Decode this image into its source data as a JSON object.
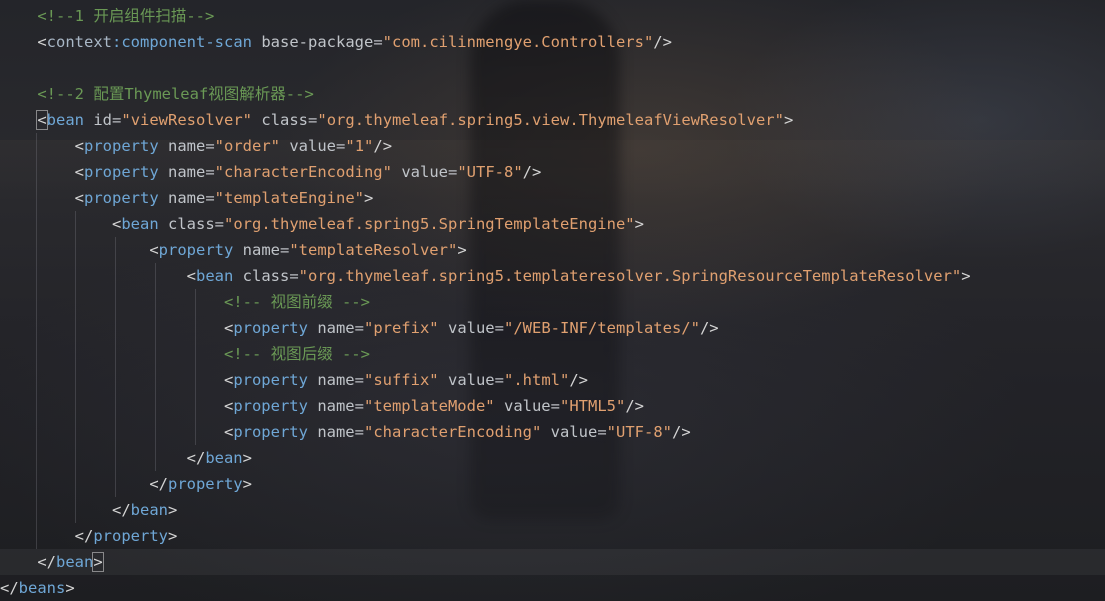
{
  "editor": {
    "lines": [
      {
        "indent": 4,
        "parts": [
          {
            "t": "comment",
            "s": "<!--1 开启组件扫描-->"
          }
        ]
      },
      {
        "indent": 4,
        "parts": [
          {
            "t": "bracket",
            "s": "<"
          },
          {
            "t": "ns",
            "s": "context"
          },
          {
            "t": "tag",
            "s": ":component-scan"
          },
          {
            "t": "plain",
            "s": " "
          },
          {
            "t": "attr",
            "s": "base-package"
          },
          {
            "t": "plain",
            "s": "="
          },
          {
            "t": "str",
            "s": "\"com.cilinmengye.Controllers\""
          },
          {
            "t": "bracket",
            "s": "/>"
          }
        ]
      },
      {
        "indent": 0,
        "parts": []
      },
      {
        "indent": 4,
        "parts": [
          {
            "t": "comment",
            "s": "<!--2 配置Thymeleaf视图解析器-->"
          }
        ]
      },
      {
        "indent": 4,
        "parts": [
          {
            "t": "bracket-box",
            "s": "<"
          },
          {
            "t": "tag",
            "s": "bean"
          },
          {
            "t": "plain",
            "s": " "
          },
          {
            "t": "attr",
            "s": "id"
          },
          {
            "t": "plain",
            "s": "="
          },
          {
            "t": "str",
            "s": "\"viewResolver\""
          },
          {
            "t": "plain",
            "s": " "
          },
          {
            "t": "attr",
            "s": "class"
          },
          {
            "t": "plain",
            "s": "="
          },
          {
            "t": "str",
            "s": "\"org.thymeleaf.spring5.view.ThymeleafViewResolver\""
          },
          {
            "t": "bracket",
            "s": ">"
          }
        ]
      },
      {
        "indent": 8,
        "parts": [
          {
            "t": "bracket",
            "s": "<"
          },
          {
            "t": "tag",
            "s": "property"
          },
          {
            "t": "plain",
            "s": " "
          },
          {
            "t": "attr",
            "s": "name"
          },
          {
            "t": "plain",
            "s": "="
          },
          {
            "t": "str",
            "s": "\"order\""
          },
          {
            "t": "plain",
            "s": " "
          },
          {
            "t": "attr",
            "s": "value"
          },
          {
            "t": "plain",
            "s": "="
          },
          {
            "t": "str",
            "s": "\"1\""
          },
          {
            "t": "bracket",
            "s": "/>"
          }
        ]
      },
      {
        "indent": 8,
        "parts": [
          {
            "t": "bracket",
            "s": "<"
          },
          {
            "t": "tag",
            "s": "property"
          },
          {
            "t": "plain",
            "s": " "
          },
          {
            "t": "attr",
            "s": "name"
          },
          {
            "t": "plain",
            "s": "="
          },
          {
            "t": "str",
            "s": "\"characterEncoding\""
          },
          {
            "t": "plain",
            "s": " "
          },
          {
            "t": "attr",
            "s": "value"
          },
          {
            "t": "plain",
            "s": "="
          },
          {
            "t": "str",
            "s": "\"UTF-8\""
          },
          {
            "t": "bracket",
            "s": "/>"
          }
        ]
      },
      {
        "indent": 8,
        "parts": [
          {
            "t": "bracket",
            "s": "<"
          },
          {
            "t": "tag",
            "s": "property"
          },
          {
            "t": "plain",
            "s": " "
          },
          {
            "t": "attr",
            "s": "name"
          },
          {
            "t": "plain",
            "s": "="
          },
          {
            "t": "str",
            "s": "\"templateEngine\""
          },
          {
            "t": "bracket",
            "s": ">"
          }
        ]
      },
      {
        "indent": 12,
        "parts": [
          {
            "t": "bracket",
            "s": "<"
          },
          {
            "t": "tag",
            "s": "bean"
          },
          {
            "t": "plain",
            "s": " "
          },
          {
            "t": "attr",
            "s": "class"
          },
          {
            "t": "plain",
            "s": "="
          },
          {
            "t": "str",
            "s": "\"org.thymeleaf.spring5.SpringTemplateEngine\""
          },
          {
            "t": "bracket",
            "s": ">"
          }
        ]
      },
      {
        "indent": 16,
        "parts": [
          {
            "t": "bracket",
            "s": "<"
          },
          {
            "t": "tag",
            "s": "property"
          },
          {
            "t": "plain",
            "s": " "
          },
          {
            "t": "attr",
            "s": "name"
          },
          {
            "t": "plain",
            "s": "="
          },
          {
            "t": "str",
            "s": "\"templateResolver\""
          },
          {
            "t": "bracket",
            "s": ">"
          }
        ]
      },
      {
        "indent": 20,
        "parts": [
          {
            "t": "bracket",
            "s": "<"
          },
          {
            "t": "tag",
            "s": "bean"
          },
          {
            "t": "plain",
            "s": " "
          },
          {
            "t": "attr",
            "s": "class"
          },
          {
            "t": "plain",
            "s": "="
          },
          {
            "t": "str",
            "s": "\"org.thymeleaf.spring5.templateresolver.SpringResourceTemplateResolver\""
          },
          {
            "t": "bracket",
            "s": ">"
          }
        ]
      },
      {
        "indent": 24,
        "parts": [
          {
            "t": "comment",
            "s": "<!-- 视图前缀 -->"
          }
        ]
      },
      {
        "indent": 24,
        "parts": [
          {
            "t": "bracket",
            "s": "<"
          },
          {
            "t": "tag",
            "s": "property"
          },
          {
            "t": "plain",
            "s": " "
          },
          {
            "t": "attr",
            "s": "name"
          },
          {
            "t": "plain",
            "s": "="
          },
          {
            "t": "str",
            "s": "\"prefix\""
          },
          {
            "t": "plain",
            "s": " "
          },
          {
            "t": "attr",
            "s": "value"
          },
          {
            "t": "plain",
            "s": "="
          },
          {
            "t": "str",
            "s": "\"/WEB-INF/templates/\""
          },
          {
            "t": "bracket",
            "s": "/>"
          }
        ]
      },
      {
        "indent": 24,
        "parts": [
          {
            "t": "comment",
            "s": "<!-- 视图后缀 -->"
          }
        ]
      },
      {
        "indent": 24,
        "parts": [
          {
            "t": "bracket",
            "s": "<"
          },
          {
            "t": "tag",
            "s": "property"
          },
          {
            "t": "plain",
            "s": " "
          },
          {
            "t": "attr",
            "s": "name"
          },
          {
            "t": "plain",
            "s": "="
          },
          {
            "t": "str",
            "s": "\"suffix\""
          },
          {
            "t": "plain",
            "s": " "
          },
          {
            "t": "attr",
            "s": "value"
          },
          {
            "t": "plain",
            "s": "="
          },
          {
            "t": "str",
            "s": "\".html\""
          },
          {
            "t": "bracket",
            "s": "/>"
          }
        ]
      },
      {
        "indent": 24,
        "parts": [
          {
            "t": "bracket",
            "s": "<"
          },
          {
            "t": "tag",
            "s": "property"
          },
          {
            "t": "plain",
            "s": " "
          },
          {
            "t": "attr",
            "s": "name"
          },
          {
            "t": "plain",
            "s": "="
          },
          {
            "t": "str",
            "s": "\"templateMode\""
          },
          {
            "t": "plain",
            "s": " "
          },
          {
            "t": "attr",
            "s": "value"
          },
          {
            "t": "plain",
            "s": "="
          },
          {
            "t": "str",
            "s": "\"HTML5\""
          },
          {
            "t": "bracket",
            "s": "/>"
          }
        ]
      },
      {
        "indent": 24,
        "parts": [
          {
            "t": "bracket",
            "s": "<"
          },
          {
            "t": "tag",
            "s": "property"
          },
          {
            "t": "plain",
            "s": " "
          },
          {
            "t": "attr",
            "s": "name"
          },
          {
            "t": "plain",
            "s": "="
          },
          {
            "t": "str",
            "s": "\"characterEncoding\""
          },
          {
            "t": "plain",
            "s": " "
          },
          {
            "t": "attr",
            "s": "value"
          },
          {
            "t": "plain",
            "s": "="
          },
          {
            "t": "str",
            "s": "\"UTF-8\""
          },
          {
            "t": "bracket",
            "s": "/>"
          }
        ]
      },
      {
        "indent": 20,
        "parts": [
          {
            "t": "bracket",
            "s": "</"
          },
          {
            "t": "tag",
            "s": "bean"
          },
          {
            "t": "bracket",
            "s": ">"
          }
        ]
      },
      {
        "indent": 16,
        "parts": [
          {
            "t": "bracket",
            "s": "</"
          },
          {
            "t": "tag",
            "s": "property"
          },
          {
            "t": "bracket",
            "s": ">"
          }
        ]
      },
      {
        "indent": 12,
        "parts": [
          {
            "t": "bracket",
            "s": "</"
          },
          {
            "t": "tag",
            "s": "bean"
          },
          {
            "t": "bracket",
            "s": ">"
          }
        ]
      },
      {
        "indent": 8,
        "parts": [
          {
            "t": "bracket",
            "s": "</"
          },
          {
            "t": "tag",
            "s": "property"
          },
          {
            "t": "bracket",
            "s": ">"
          }
        ]
      },
      {
        "indent": 4,
        "parts": [
          {
            "t": "bracket",
            "s": "</"
          },
          {
            "t": "tag",
            "s": "bean"
          },
          {
            "t": "bracket-box",
            "s": ">"
          }
        ]
      },
      {
        "indent": 0,
        "parts": [
          {
            "t": "bracket",
            "s": "</"
          },
          {
            "t": "tag",
            "s": "beans"
          },
          {
            "t": "bracket",
            "s": ">"
          }
        ]
      }
    ]
  },
  "colors": {
    "comment": "#6a9955",
    "tag": "#6fa7d6",
    "attribute": "#c0c4c9",
    "string": "#d9a36b",
    "bracket": "#d4d4d4"
  }
}
